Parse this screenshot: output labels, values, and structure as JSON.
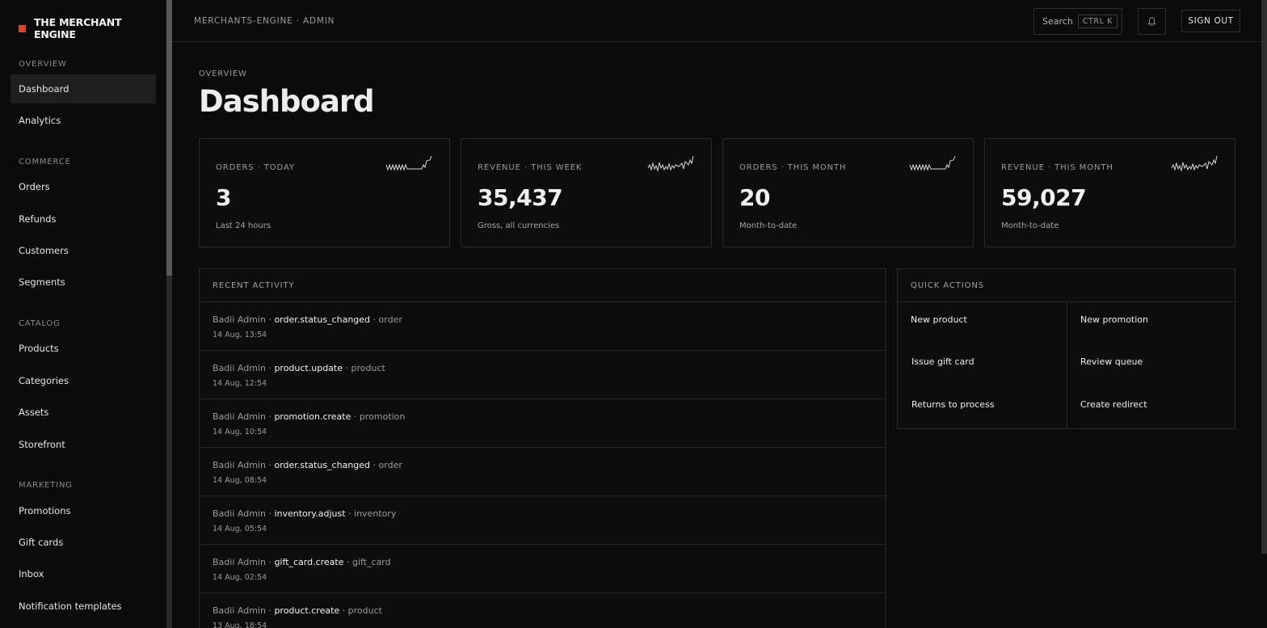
{
  "brand": {
    "name": "THE MERCHANT ENGINE",
    "accent": "#e5421b"
  },
  "sidebar": {
    "sections": [
      {
        "label": "OVERVIEW",
        "items": [
          {
            "label": "Dashboard",
            "active": true
          },
          {
            "label": "Analytics"
          }
        ]
      },
      {
        "label": "COMMERCE",
        "items": [
          {
            "label": "Orders"
          },
          {
            "label": "Refunds"
          },
          {
            "label": "Customers"
          },
          {
            "label": "Segments"
          }
        ]
      },
      {
        "label": "CATALOG",
        "items": [
          {
            "label": "Products"
          },
          {
            "label": "Categories"
          },
          {
            "label": "Assets"
          },
          {
            "label": "Storefront"
          }
        ]
      },
      {
        "label": "MARKETING",
        "items": [
          {
            "label": "Promotions"
          },
          {
            "label": "Gift cards"
          },
          {
            "label": "Inbox"
          },
          {
            "label": "Notification templates"
          }
        ]
      }
    ]
  },
  "topbar": {
    "breadcrumb": "MERCHANTS-ENGINE · ADMIN",
    "search_label": "Search",
    "search_shortcut": "CTRL K",
    "bell_icon": "bell-icon",
    "signout_label": "SIGN OUT"
  },
  "page": {
    "eyebrow": "OVERVIEW",
    "title": "Dashboard"
  },
  "stats": [
    {
      "label": "ORDERS · TODAY",
      "value": "3",
      "sub": "Last 24 hours"
    },
    {
      "label": "REVENUE · THIS WEEK",
      "value": "35,437",
      "sub": "Gross, all currencies"
    },
    {
      "label": "ORDERS · THIS MONTH",
      "value": "20",
      "sub": "Month-to-date"
    },
    {
      "label": "REVENUE · THIS MONTH",
      "value": "59,027",
      "sub": "Month-to-date"
    }
  ],
  "activity": {
    "title": "RECENT ACTIVITY",
    "rows": [
      {
        "actor": "Badii Admin",
        "event": "order.status_changed",
        "entity": "order",
        "time": "14 Aug, 13:54"
      },
      {
        "actor": "Badii Admin",
        "event": "product.update",
        "entity": "product",
        "time": "14 Aug, 12:54"
      },
      {
        "actor": "Badii Admin",
        "event": "promotion.create",
        "entity": "promotion",
        "time": "14 Aug, 10:54"
      },
      {
        "actor": "Badii Admin",
        "event": "order.status_changed",
        "entity": "order",
        "time": "14 Aug, 08:54"
      },
      {
        "actor": "Badii Admin",
        "event": "inventory.adjust",
        "entity": "inventory",
        "time": "14 Aug, 05:54"
      },
      {
        "actor": "Badii Admin",
        "event": "gift_card.create",
        "entity": "gift_card",
        "time": "14 Aug, 02:54"
      },
      {
        "actor": "Badii Admin",
        "event": "product.create",
        "entity": "product",
        "time": "13 Aug, 18:54"
      }
    ]
  },
  "quick_actions": {
    "title": "QUICK ACTIONS",
    "items": [
      "New product",
      "New promotion",
      "Issue gift card",
      "Review queue",
      "Returns to process",
      "Create redirect"
    ]
  }
}
